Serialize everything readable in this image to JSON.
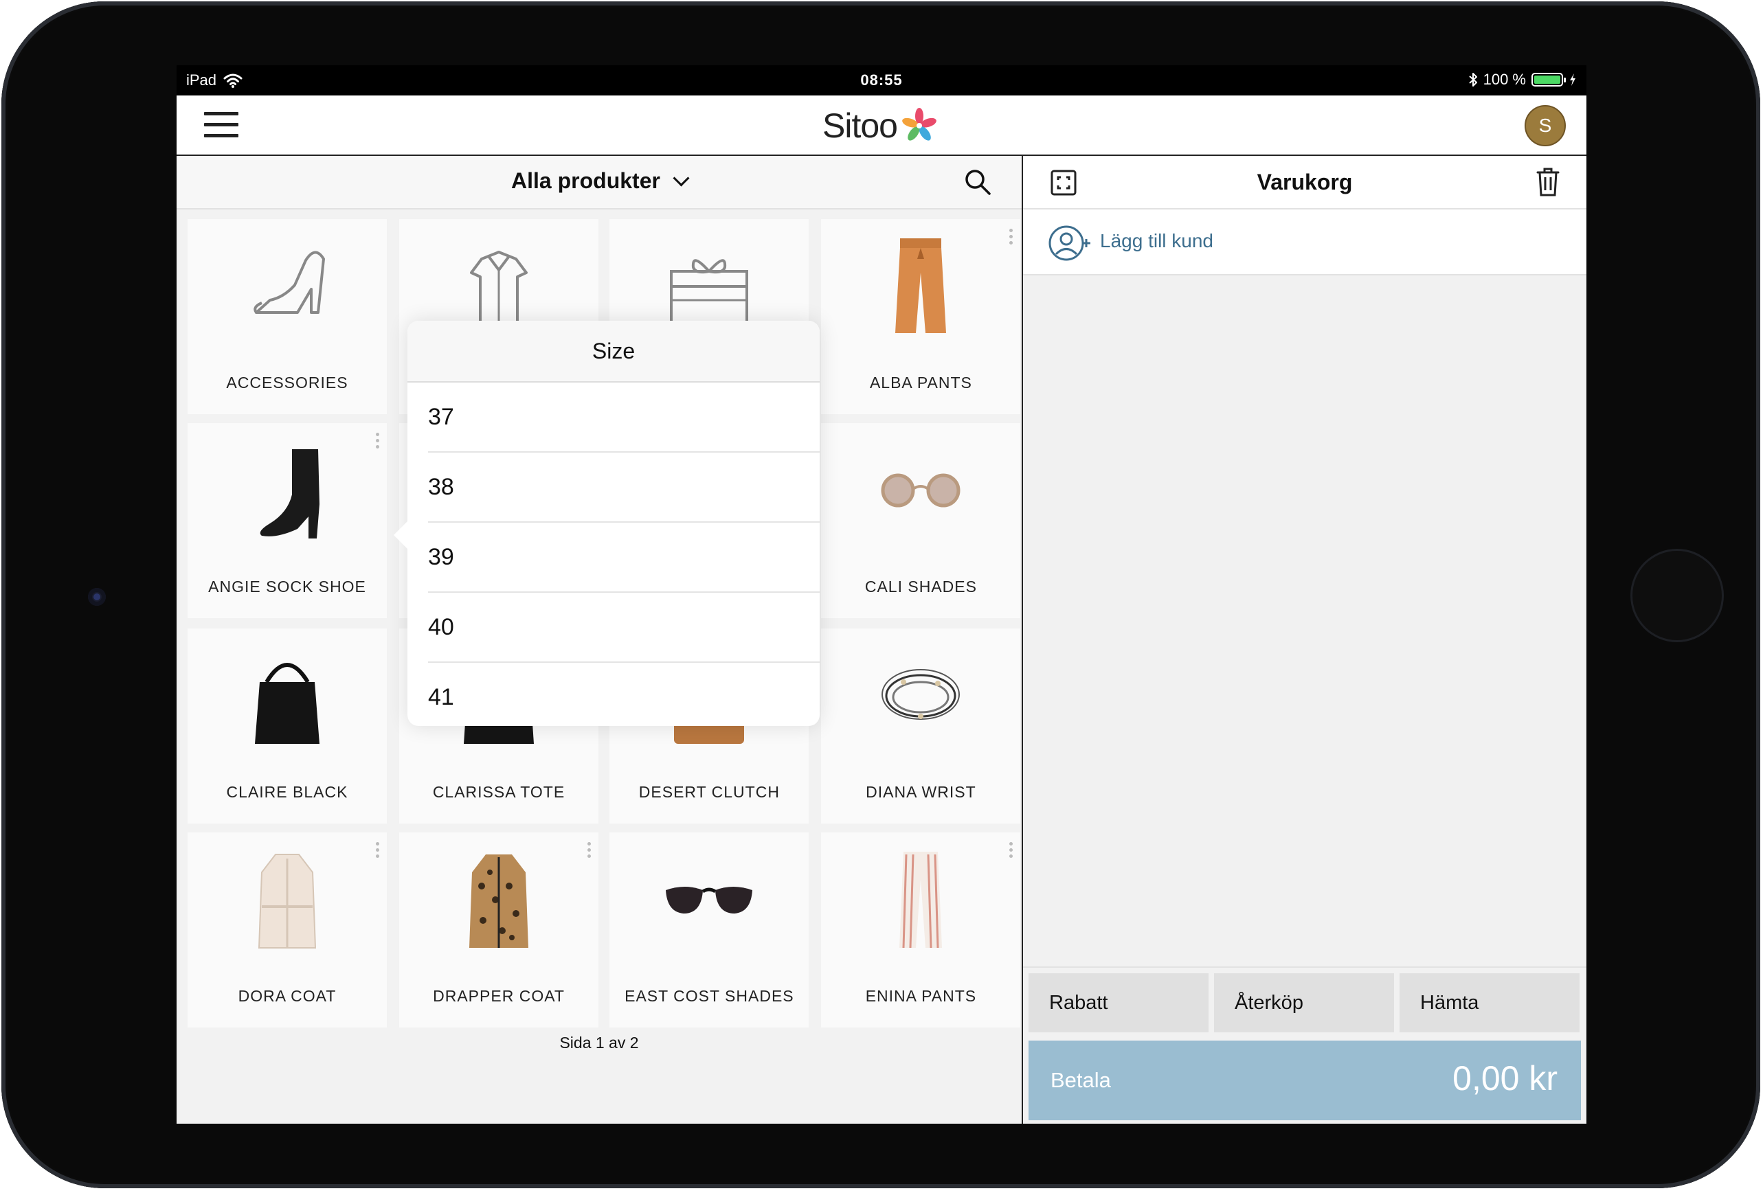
{
  "status_bar": {
    "device": "iPad",
    "time": "08:55",
    "battery": "100 %",
    "battery_fraction": 1.0
  },
  "header": {
    "logo": "Sitoo",
    "avatar_initial": "S"
  },
  "products": {
    "filter_title": "Alla produkter",
    "pager": "Sida 1 av 2",
    "tiles": [
      {
        "label": "ACCESSORIES",
        "image": "heel-shoe-icon"
      },
      {
        "label": "",
        "image": "shirt-icon"
      },
      {
        "label": "",
        "image": "gift-box-icon"
      },
      {
        "label": "ALBA PANTS",
        "image": "orange-paperbag-pants"
      },
      {
        "label": "ANGIE SOCK SHOE",
        "image": "black-ankle-boot"
      },
      {
        "label": "",
        "image": ""
      },
      {
        "label": "",
        "image": ""
      },
      {
        "label": "CALI SHADES",
        "image": "round-sunglasses"
      },
      {
        "label": "CLAIRE BLACK",
        "image": "black-suede-bag"
      },
      {
        "label": "CLARISSA TOTE",
        "image": "black-tote-bag"
      },
      {
        "label": "DESERT CLUTCH",
        "image": "tan-clutch"
      },
      {
        "label": "DIANA WRIST",
        "image": "beaded-bracelets"
      },
      {
        "label": "DORA COAT",
        "image": "cream-coat"
      },
      {
        "label": "DRAPPER COAT",
        "image": "leopard-coat"
      },
      {
        "label": "EAST COST SHADES",
        "image": "cat-eye-sunglasses"
      },
      {
        "label": "ENINA PANTS",
        "image": "striped-pants"
      }
    ]
  },
  "size_popover": {
    "title": "Size",
    "options": [
      "37",
      "38",
      "39",
      "40",
      "41"
    ]
  },
  "cart": {
    "title": "Varukorg",
    "add_customer": "Lägg till kund",
    "actions": [
      "Rabatt",
      "Återköp",
      "Hämta"
    ],
    "pay_label": "Betala",
    "pay_amount": "0,00 kr"
  },
  "colors": {
    "accent": "#3d6e8e",
    "pay": "#9abdd1",
    "avatar": "#9b7b3c"
  }
}
